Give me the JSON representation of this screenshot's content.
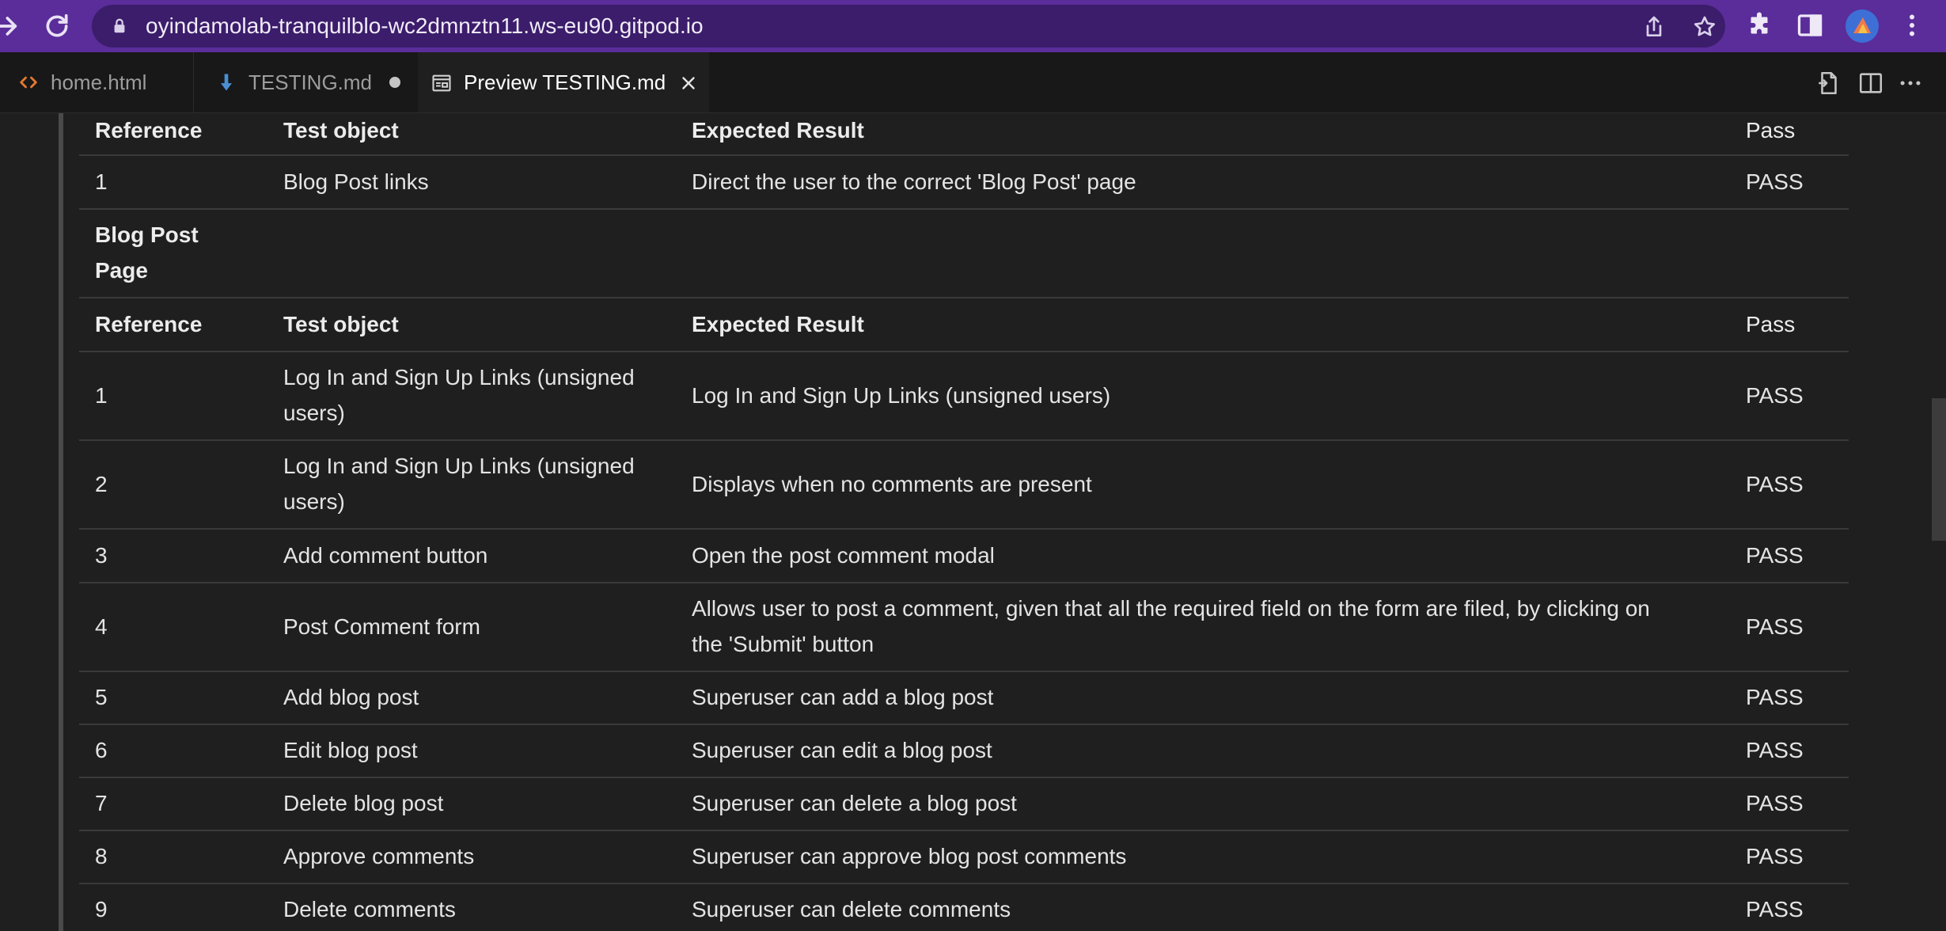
{
  "browser": {
    "url": "oyindamolab-tranquilblo-wc2dmnztn11.ws-eu90.gitpod.io",
    "accent_color": "#5a2d9a"
  },
  "editor": {
    "tabs": [
      {
        "label": "home.html",
        "icon": "html-file-icon",
        "active": false
      },
      {
        "label": "TESTING.md",
        "icon": "markdown-file-icon",
        "active": false,
        "dirty": true
      },
      {
        "label": "Preview TESTING.md",
        "icon": "preview-icon",
        "active": true
      }
    ]
  },
  "table": {
    "top_header": {
      "ref": "Reference",
      "object": "Test object",
      "expected": "Expected Result",
      "pass": "Pass"
    },
    "first_rows": [
      {
        "ref": "1",
        "object": "Blog Post links",
        "expected": "Direct the user to the correct 'Blog Post' page",
        "pass": "PASS"
      }
    ],
    "section_title_line1": "Blog Post",
    "section_title_line2": "Page",
    "section_header": {
      "ref": "Reference",
      "object": "Test object",
      "expected": "Expected Result",
      "pass": "Pass"
    },
    "rows": [
      {
        "ref": "1",
        "object_l1": "Log In and Sign Up Links (unsigned",
        "object_l2": "users)",
        "expected": "Log In and Sign Up Links (unsigned users)",
        "pass": "PASS"
      },
      {
        "ref": "2",
        "object_l1": "Log In and Sign Up Links (unsigned",
        "object_l2": "users)",
        "expected": "Displays when no comments are present",
        "pass": "PASS"
      },
      {
        "ref": "3",
        "object": "Add comment button",
        "expected": "Open the post comment modal",
        "pass": "PASS"
      },
      {
        "ref": "4",
        "object": "Post Comment form",
        "expected_l1": "Allows user to post a comment, given that all the required field on the form are filed, by clicking on",
        "expected_l2": "the 'Submit' button",
        "pass": "PASS"
      },
      {
        "ref": "5",
        "object": "Add blog post",
        "expected": "Superuser can add a blog post",
        "pass": "PASS"
      },
      {
        "ref": "6",
        "object": "Edit blog post",
        "expected": "Superuser can edit a blog post",
        "pass": "PASS"
      },
      {
        "ref": "7",
        "object": "Delete blog post",
        "expected": "Superuser can delete a blog post",
        "pass": "PASS"
      },
      {
        "ref": "8",
        "object": "Approve comments",
        "expected": "Superuser can approve blog post comments",
        "pass": "PASS"
      },
      {
        "ref": "9",
        "object": "Delete comments",
        "expected": "Superuser can delete comments",
        "pass": "PASS"
      }
    ]
  }
}
